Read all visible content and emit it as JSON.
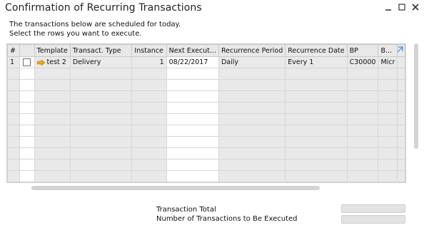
{
  "window": {
    "title": "Confirmation of Recurring Transactions",
    "controls": {
      "minimize": "_",
      "maximize": "□",
      "close": "×"
    }
  },
  "intro": {
    "line1": "The transactions below are scheduled for today.",
    "line2": "Select the rows you want to execute."
  },
  "grid": {
    "columns": [
      "#",
      "",
      "Template",
      "Transact. Type",
      "Instance",
      "Next Execut...",
      "Recurrence Period",
      "Recurrence Date",
      "BP",
      "B..."
    ],
    "rows": [
      {
        "no": "1",
        "checked": false,
        "template": "test 2",
        "type": "Delivery",
        "instance": "1",
        "next_execution": "08/22/2017",
        "period": "Daily",
        "recurrence_date": "Every 1",
        "bp": "C30000",
        "bp_name": "Micr"
      }
    ],
    "empty_row_count": 10,
    "template_arrow_color": "#f0a30a",
    "expand_icon_color": "#4a8fd6"
  },
  "totals": {
    "transaction_total_label": "Transaction Total",
    "count_label": "Number of Transactions to Be Executed"
  }
}
